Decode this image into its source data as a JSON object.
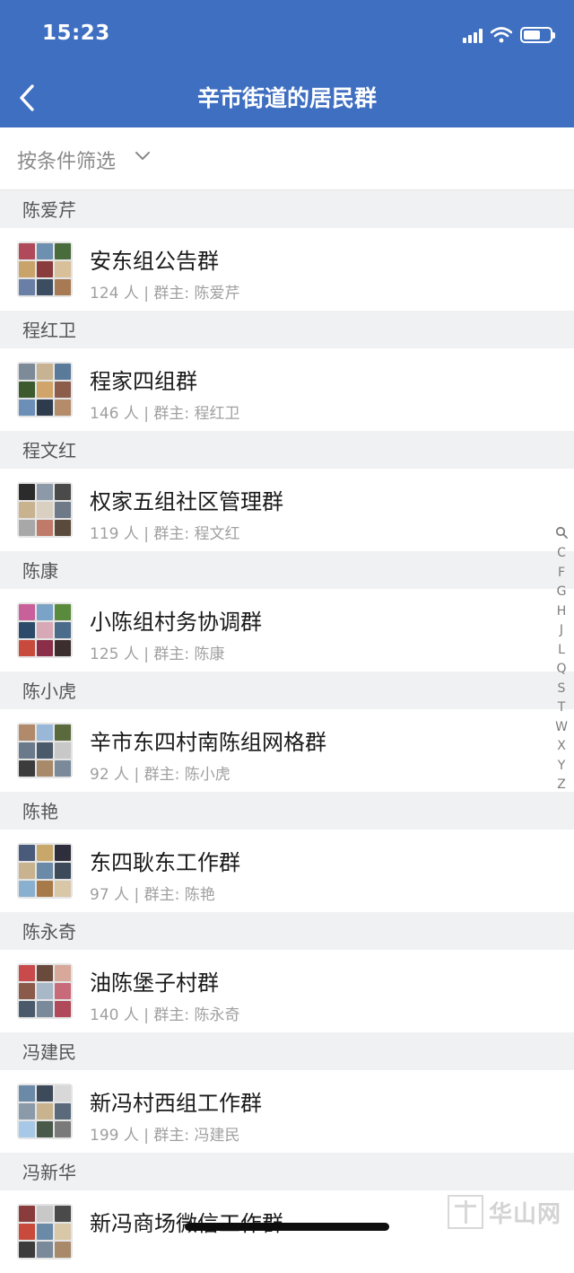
{
  "status_bar": {
    "time": "15:23"
  },
  "nav": {
    "title": "辛市街道的居民群",
    "back_icon": "chevron-left-icon"
  },
  "filter": {
    "label": "按条件筛选"
  },
  "groups": [
    {
      "owner": "陈爱芹",
      "name": "安东组公告群",
      "meta": "124 人 | 群主: 陈爱芹",
      "avatar_colors": [
        "#b04a5a",
        "#6d8fb0",
        "#4a6b3c",
        "#c9a46a",
        "#8a3b3b",
        "#d8c09a",
        "#6a7fa5",
        "#3c4d62",
        "#a77a54"
      ]
    },
    {
      "owner": "程红卫",
      "name": "程家四组群",
      "meta": "146 人 | 群主: 程红卫",
      "avatar_colors": [
        "#7d8b99",
        "#c7b391",
        "#5a7a9a",
        "#3c5a2e",
        "#d1a56a",
        "#8b5d4a",
        "#6c8fb8",
        "#2e3b4d",
        "#b48c6a"
      ]
    },
    {
      "owner": "程文红",
      "name": "权家五组社区管理群",
      "meta": "119 人 | 群主: 程文红",
      "avatar_colors": [
        "#2b2b2b",
        "#8c9aa8",
        "#4a4a4a",
        "#c8b38e",
        "#d9d0c2",
        "#6e7a88",
        "#a8a8a8",
        "#c07a6a",
        "#5a4a3c"
      ]
    },
    {
      "owner": "陈康",
      "name": "小陈组村务协调群",
      "meta": "125 人 | 群主: 陈康",
      "avatar_colors": [
        "#c8609a",
        "#7aa3c7",
        "#5a8a3c",
        "#2e4a6a",
        "#d7a8b5",
        "#4a6b8a",
        "#c84a3c",
        "#8a2e4a",
        "#3c2e2e"
      ]
    },
    {
      "owner": "陈小虎",
      "name": "辛市东四村南陈组网格群",
      "meta": "92 人 | 群主: 陈小虎",
      "avatar_colors": [
        "#b08a6a",
        "#9ab7d7",
        "#5a6a3c",
        "#6a7a8a",
        "#4a5a6a",
        "#c8c8c8",
        "#3c3c3c",
        "#a88a6a",
        "#7a8a9a"
      ]
    },
    {
      "owner": "陈艳",
      "name": "东四耿东工作群",
      "meta": "97 人 | 群主: 陈艳",
      "avatar_colors": [
        "#4a5a7a",
        "#c7a86a",
        "#2e2e3c",
        "#c8b38e",
        "#6a8aa8",
        "#3c4a5a",
        "#8ab0d0",
        "#a87a4a",
        "#d8c8a8"
      ]
    },
    {
      "owner": "陈永奇",
      "name": "油陈堡子村群",
      "meta": "140 人 | 群主: 陈永奇",
      "avatar_colors": [
        "#c84a4a",
        "#6a4a3c",
        "#d8a89a",
        "#8a5a4a",
        "#a8b8c8",
        "#c86a7a",
        "#4a5a6a",
        "#7a8a9a",
        "#b04a5a"
      ]
    },
    {
      "owner": "冯建民",
      "name": "新冯村西组工作群",
      "meta": "199 人 | 群主: 冯建民",
      "avatar_colors": [
        "#6a8aa8",
        "#3c4a5a",
        "#d8d8d8",
        "#8a9aa8",
        "#c8b38e",
        "#5a6a7a",
        "#a8c8e8",
        "#4a5a4a",
        "#7a7a7a"
      ]
    },
    {
      "owner": "冯新华",
      "name": "新冯商场微信工作群",
      "meta": "",
      "avatar_colors": [
        "#8a3b3b",
        "#c8c8c8",
        "#4a4a4a",
        "#c84a3c",
        "#6a8aa8",
        "#d8c8a8",
        "#3c3c3c",
        "#7a8a9a",
        "#a88a6a"
      ]
    }
  ],
  "index_bar": {
    "search_icon": "magnifier-icon",
    "letters": [
      "C",
      "F",
      "G",
      "H",
      "J",
      "L",
      "Q",
      "S",
      "T",
      "W",
      "X",
      "Y",
      "Z"
    ]
  },
  "watermark": {
    "text": "华山网"
  },
  "colors": {
    "header_bg": "#3f6fc1",
    "section_bg": "#f0f1f3"
  }
}
